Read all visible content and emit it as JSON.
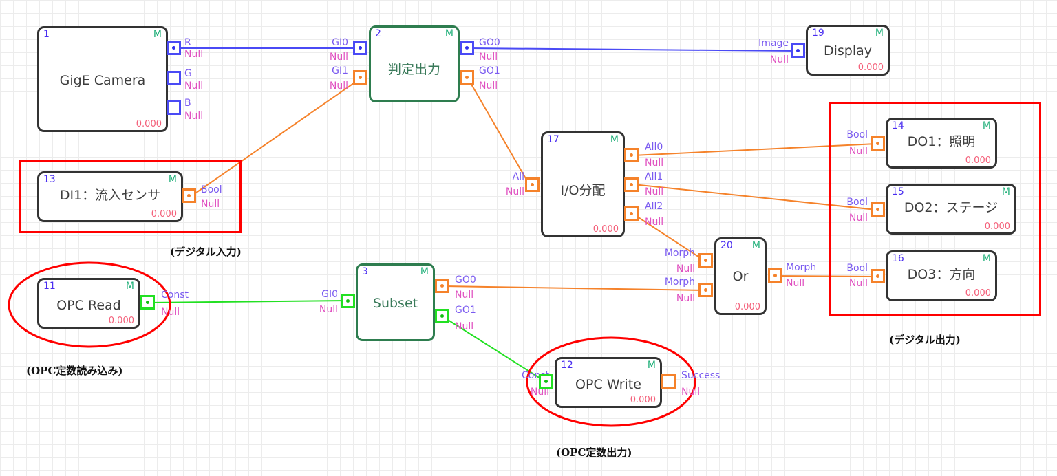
{
  "colors": {
    "wire_image": "#4a4af5",
    "wire_bool": "#f5822a",
    "wire_const": "#22e022",
    "highlight": "#ff0000",
    "node_border": "#333333",
    "node_border_group": "#2e7d4f"
  },
  "nodes": [
    {
      "id": "1",
      "title": "GigE Camera",
      "flag": "M",
      "value": "0.000"
    },
    {
      "id": "2",
      "title": "判定出力",
      "flag": "M",
      "value": ""
    },
    {
      "id": "19",
      "title": "Display",
      "flag": "M",
      "value": "0.000"
    },
    {
      "id": "13",
      "title": "DI1：流入センサ",
      "flag": "M",
      "value": "0.000"
    },
    {
      "id": "17",
      "title": "I/O分配",
      "flag": "M",
      "value": "0.000"
    },
    {
      "id": "14",
      "title": "DO1：照明",
      "flag": "M",
      "value": "0.000"
    },
    {
      "id": "15",
      "title": "DO2：ステージ",
      "flag": "M",
      "value": "0.000"
    },
    {
      "id": "16",
      "title": "DO3：方向",
      "flag": "M",
      "value": "0.000"
    },
    {
      "id": "20",
      "title": "Or",
      "flag": "M",
      "value": "0.000"
    },
    {
      "id": "3",
      "title": "Subset",
      "flag": "M",
      "value": ""
    },
    {
      "id": "11",
      "title": "OPC Read",
      "flag": "M",
      "value": "0.000"
    },
    {
      "id": "12",
      "title": "OPC Write",
      "flag": "M",
      "value": "0.000"
    }
  ],
  "ports": {
    "n1_out": [
      {
        "type": "R",
        "val": "Null"
      },
      {
        "type": "G",
        "val": "Null"
      },
      {
        "type": "B",
        "val": "Null"
      }
    ],
    "n2_in": [
      {
        "type": "GI0",
        "val": "Null"
      },
      {
        "type": "GI1",
        "val": "Null"
      }
    ],
    "n2_out": [
      {
        "type": "GO0",
        "val": "Null"
      },
      {
        "type": "GO1",
        "val": "Null"
      }
    ],
    "n19_in": [
      {
        "type": "Image",
        "val": "Null"
      }
    ],
    "n13_out": [
      {
        "type": "Bool",
        "val": "Null"
      }
    ],
    "n17_in": [
      {
        "type": "All",
        "val": "Null"
      }
    ],
    "n17_out": [
      {
        "type": "All0",
        "val": "Null"
      },
      {
        "type": "All1",
        "val": "Null"
      },
      {
        "type": "All2",
        "val": "Null"
      }
    ],
    "n14_in": [
      {
        "type": "Bool",
        "val": "Null"
      }
    ],
    "n15_in": [
      {
        "type": "Bool",
        "val": "Null"
      }
    ],
    "n16_in": [
      {
        "type": "Bool",
        "val": "Null"
      }
    ],
    "n20_in": [
      {
        "type": "Morph",
        "val": "Null"
      },
      {
        "type": "Morph",
        "val": "Null"
      }
    ],
    "n20_out": [
      {
        "type": "Morph",
        "val": "Null"
      }
    ],
    "n3_in": [
      {
        "type": "GI0",
        "val": "Null"
      }
    ],
    "n3_out": [
      {
        "type": "GO0",
        "val": "Null"
      },
      {
        "type": "GO1",
        "val": "Null"
      }
    ],
    "n11_out": [
      {
        "type": "Const",
        "val": "Null"
      }
    ],
    "n12_in": [
      {
        "type": "Const",
        "val": "Null"
      }
    ],
    "n12_out": [
      {
        "type": "Success",
        "val": "Null"
      }
    ]
  },
  "connections": [
    {
      "from": "1.R",
      "to": "2.GI0",
      "kind": "image"
    },
    {
      "from": "2.GO0",
      "to": "19.Image",
      "kind": "image"
    },
    {
      "from": "13.Bool",
      "to": "2.GI1",
      "kind": "bool"
    },
    {
      "from": "2.GO1",
      "to": "17.All",
      "kind": "bool"
    },
    {
      "from": "17.All0",
      "to": "14.Bool",
      "kind": "bool"
    },
    {
      "from": "17.All1",
      "to": "15.Bool",
      "kind": "bool"
    },
    {
      "from": "17.All2",
      "to": "20.Morph",
      "kind": "bool"
    },
    {
      "from": "3.GO0",
      "to": "20.Morph",
      "kind": "bool"
    },
    {
      "from": "20.Morph",
      "to": "16.Bool",
      "kind": "bool"
    },
    {
      "from": "11.Const",
      "to": "3.GI0",
      "kind": "const"
    },
    {
      "from": "3.GO1",
      "to": "12.Const",
      "kind": "const"
    }
  ],
  "annotations": {
    "digital_input": "(デジタル入力)",
    "digital_output": "(デジタル出力)",
    "opc_read": "(OPC定数読み込み)",
    "opc_write": "(OPC定数出力)"
  }
}
